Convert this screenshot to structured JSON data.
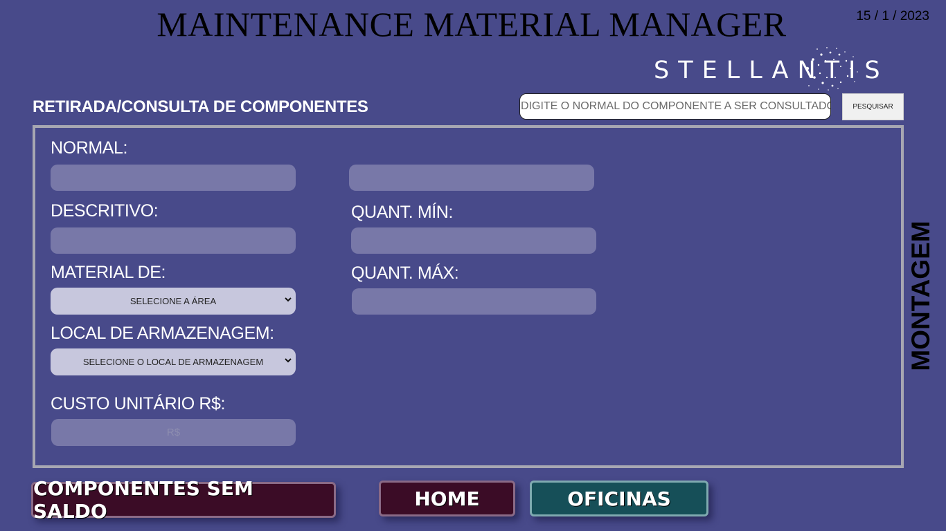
{
  "header": {
    "title": "MAINTENANCE MATERIAL MANAGER",
    "date": "15 / 1 / 2023",
    "logo_text": "STELLANTIS"
  },
  "search": {
    "placeholder": "DIGITE O NORMAL DO COMPONENTE A SER CONSULTADO",
    "button_label": "PESQUISAR"
  },
  "section_title": "RETIRADA/CONSULTA DE COMPONENTES",
  "form": {
    "normal_label": "NORMAL:",
    "descritivo_label": "DESCRITIVO:",
    "material_label": "MATERIAL DE:",
    "material_select": "SELECIONE A ÁREA",
    "local_label": "LOCAL DE ARMAZENAGEM:",
    "local_select": "SELECIONE O LOCAL DE ARMAZENAGEM",
    "custo_label": "CUSTO UNITÁRIO R$:",
    "custo_placeholder": "R$",
    "quant_min_label": "QUANT. MÍN:",
    "quant_max_label": "QUANT. MÁX:"
  },
  "side_label": "MONTAGEM",
  "buttons": {
    "sem_saldo": "COMPONENTES SEM SALDO",
    "home": "HOME",
    "oficinas": "OFICINAS"
  },
  "colors": {
    "background": "#484a8a",
    "field": "#7878a8",
    "select": "#c7c7dd",
    "maroon": "#3b0c26",
    "teal": "#164f58"
  }
}
